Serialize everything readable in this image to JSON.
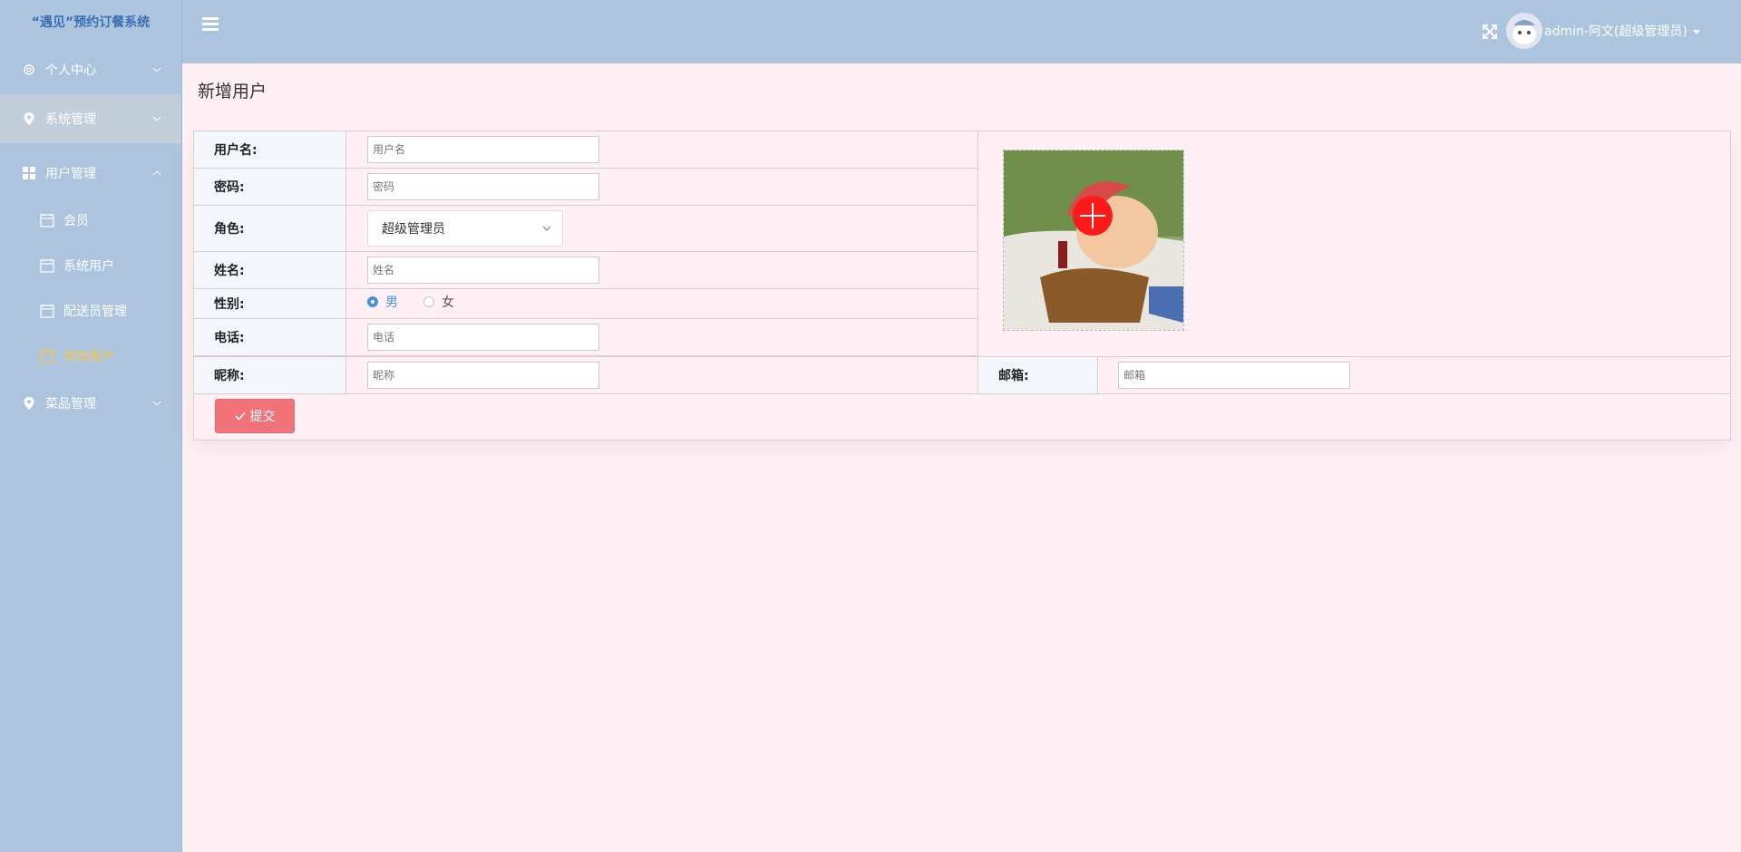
{
  "app": {
    "title": "“遇见”预约订餐系统"
  },
  "sidebar": {
    "items": [
      {
        "label": "个人中心",
        "icon": "gear-icon"
      },
      {
        "label": "系统管理",
        "icon": "location-pin-icon"
      },
      {
        "label": "用户管理",
        "icon": "grid-icon"
      },
      {
        "label": "菜品管理",
        "icon": "location-pin-icon"
      }
    ],
    "subitems": [
      {
        "label": "会员",
        "icon": "calendar-icon"
      },
      {
        "label": "系统用户",
        "icon": "calendar-icon"
      },
      {
        "label": "配送员管理",
        "icon": "calendar-icon"
      },
      {
        "label": "添加用户",
        "icon": "calendar-icon"
      }
    ]
  },
  "header": {
    "user_label": "admin-阿文(超级管理员)"
  },
  "page": {
    "title": "新增用户"
  },
  "form": {
    "username": {
      "label": "用户名:",
      "placeholder": "用户名",
      "value": ""
    },
    "password": {
      "label": "密码:",
      "placeholder": "密码",
      "value": ""
    },
    "role": {
      "label": "角色:",
      "value": "超级管理员"
    },
    "name": {
      "label": "姓名:",
      "placeholder": "姓名",
      "value": ""
    },
    "gender": {
      "label": "性别:",
      "options": [
        "男",
        "女"
      ],
      "selected": "男"
    },
    "phone": {
      "label": "电话:",
      "placeholder": "电话",
      "value": ""
    },
    "nickname": {
      "label": "昵称:",
      "placeholder": "昵称",
      "value": ""
    },
    "email": {
      "label": "邮箱:",
      "placeholder": "邮箱",
      "value": ""
    },
    "submit_label": "提交"
  },
  "colors": {
    "sidebar_bg": "#adc4df",
    "content_bg": "#fff0f5",
    "accent_blue": "#4a90e2",
    "selected_menu": "#f6c84a",
    "submit_bg": "#f2727a"
  }
}
